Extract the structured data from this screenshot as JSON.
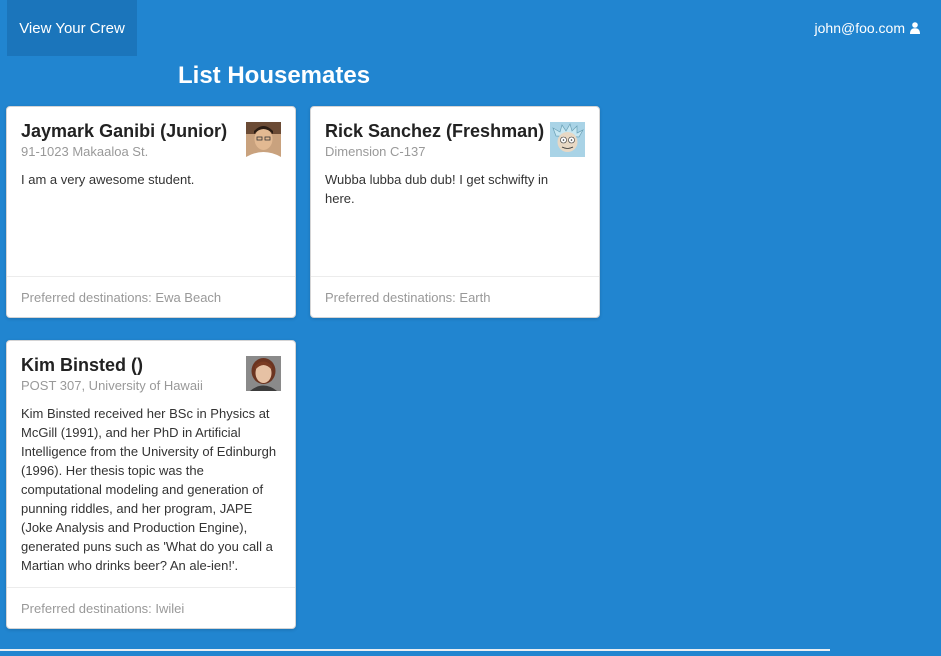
{
  "nav": {
    "crew_label": "View Your Crew",
    "user_email": "john@foo.com",
    "user_icon": "user-icon"
  },
  "page": {
    "title": "List Housemates"
  },
  "housemates": [
    {
      "name": "Jaymark Ganibi (Junior)",
      "address": "91-1023 Makaaloa St.",
      "description": "I am a very awesome student.",
      "destinations": "Preferred destinations: Ewa Beach"
    },
    {
      "name": "Rick Sanchez (Freshman)",
      "address": "Dimension C-137",
      "description": "Wubba lubba dub dub! I get schwifty in here.",
      "destinations": "Preferred destinations: Earth"
    },
    {
      "name": "Kim Binsted ()",
      "address": "POST 307, University of Hawaii",
      "description": "Kim Binsted received her BSc in Physics at McGill (1991), and her PhD in Artificial Intelligence from the University of Edinburgh (1996). Her thesis topic was the computational modeling and generation of punning riddles, and her program, JAPE (Joke Analysis and Production Engine), generated puns such as 'What do you call a Martian who drinks beer? An ale-ien!'.",
      "destinations": "Preferred destinations: Iwilei"
    }
  ],
  "colors": {
    "background": "#2185d0",
    "active_nav": "#1b75bb"
  }
}
